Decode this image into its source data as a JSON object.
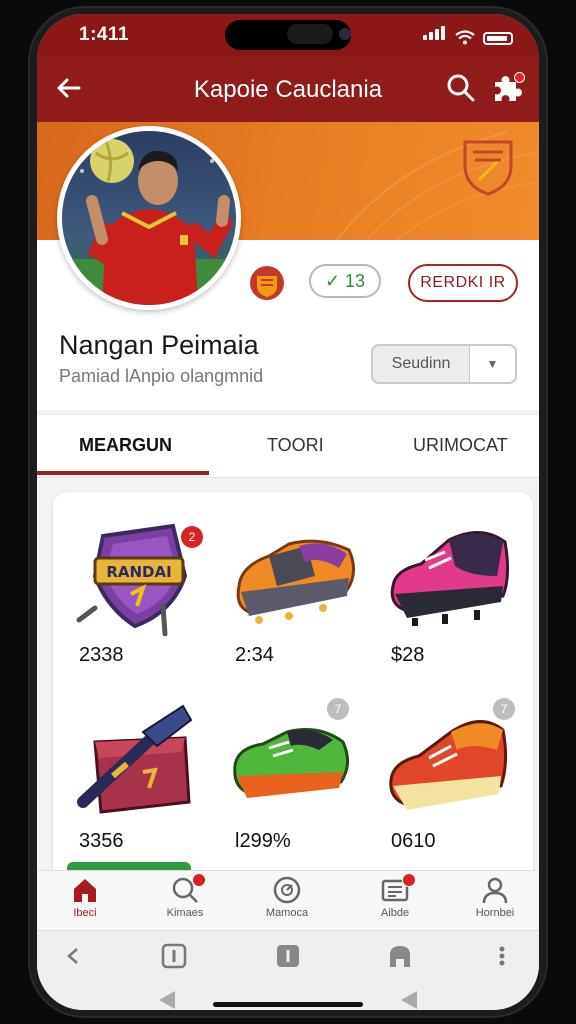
{
  "status_bar": {
    "time": "1:411"
  },
  "app_bar": {
    "title": "Kapoie Cauclania"
  },
  "profile": {
    "score": "✓ 13",
    "follow_label": "RERDKI IR",
    "name": "Nangan Peimaia",
    "subtitle": "Pamiad  lAnpio  olangmnid",
    "select_value": "Seudinn"
  },
  "tabs": [
    {
      "label": "MEARGUN",
      "active": true
    },
    {
      "label": "TOORI",
      "active": false
    },
    {
      "label": "URIMOCAT",
      "active": false
    }
  ],
  "items": [
    {
      "name": "shield-badge",
      "price": "2338",
      "badge": "2",
      "badge_color": "#d62323",
      "label": "RANDAI"
    },
    {
      "name": "orange-boot",
      "price": "2:34",
      "badge": "",
      "badge_color": ""
    },
    {
      "name": "pink-sneaker",
      "price": "$28",
      "badge": "",
      "badge_color": ""
    },
    {
      "name": "treasure-box",
      "price": "3356",
      "badge": "",
      "badge_color": ""
    },
    {
      "name": "green-shoe",
      "price": "l299%",
      "badge": "7",
      "badge_color": "#bdbdbd"
    },
    {
      "name": "red-sneaker",
      "price": "0610",
      "badge": "7",
      "badge_color": "#bdbdbd"
    }
  ],
  "bottom_nav": [
    {
      "label": "Ibeci",
      "icon": "home-icon",
      "active": true,
      "dot": false
    },
    {
      "label": "Kimaes",
      "icon": "search-icon",
      "active": false,
      "dot": true
    },
    {
      "label": "Mamoca",
      "icon": "clock-icon",
      "active": false,
      "dot": false
    },
    {
      "label": "Aibde",
      "icon": "news-icon",
      "active": false,
      "dot": true
    },
    {
      "label": "Hornbei",
      "icon": "profile-icon",
      "active": false,
      "dot": false
    }
  ],
  "colors": {
    "primary": "#8f1b1b",
    "banner": "#e97f24",
    "accent_green": "#2f8a3a"
  }
}
